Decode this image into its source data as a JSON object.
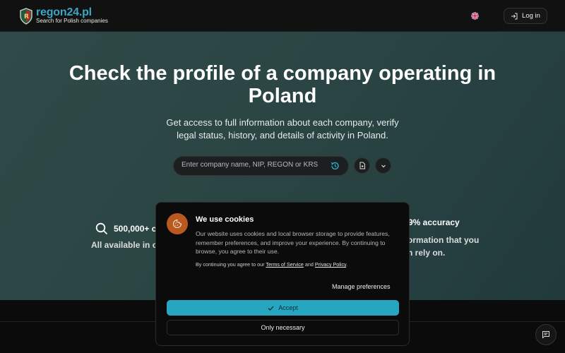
{
  "header": {
    "logo_title": "regon24.pl",
    "logo_subtitle": "Search for Polish companies",
    "login_label": "Log in",
    "language": "English (UK flag)"
  },
  "hero": {
    "title_line1": "Check the profile of a company operating in",
    "title_line2": "Poland",
    "subtitle_line1": "Get access to full information about each company, verify",
    "subtitle_line2": "legal status, history, and details of activity in Poland.",
    "search_placeholder": "Enter company name, NIP, REGON or KRS"
  },
  "stats": {
    "left_value": "500,000+ c",
    "left_desc": "All available in ou",
    "right_value": "9% accuracy",
    "right_desc_line1": "ormation that you",
    "right_desc_line2": "n rely on."
  },
  "cookie": {
    "title": "We use cookies",
    "body": "Our website uses cookies and local browser storage to provide features, remember preferences, and improve your experience. By continuing to browse, you agree to their use.",
    "terms_prefix": "By continuing you agree to our",
    "terms_link": "Terms of Service",
    "terms_and": "and",
    "privacy_link": "Privacy Policy",
    "terms_suffix": ".",
    "manage_label": "Manage preferences",
    "accept_label": "Accept",
    "necessary_label": "Only necessary"
  },
  "colors": {
    "brand": "#3aa7c4",
    "accept": "#27a6c1",
    "cookie_icon": "#b9581f",
    "hero_bg": "#2b4544"
  },
  "icons": [
    "shield-logo-icon",
    "uk-flag-icon",
    "login-icon",
    "history-icon",
    "document-icon",
    "chevron-down-icon",
    "search-icon",
    "cookie-icon",
    "check-icon",
    "chat-icon"
  ]
}
